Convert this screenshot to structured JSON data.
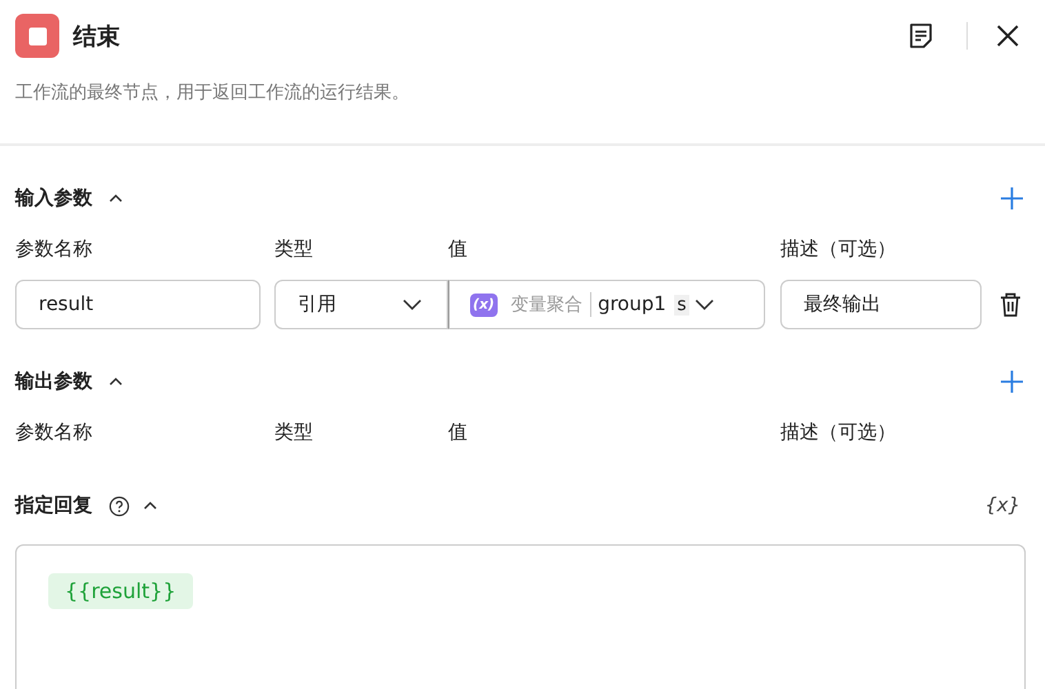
{
  "header": {
    "title": "结束",
    "description": "工作流的最终节点，用于返回工作流的运行结果。"
  },
  "input_section": {
    "title": "输入参数",
    "expanded": true,
    "columns": [
      "参数名称",
      "类型",
      "值",
      "描述（可选）"
    ],
    "rows": [
      {
        "name": "result",
        "type": "引用",
        "value_badge": "(x)",
        "value_source": "变量聚合",
        "value_name": "group1",
        "value_tail": "s",
        "description": "最终输出"
      }
    ]
  },
  "output_section": {
    "title": "输出参数",
    "expanded": true,
    "columns": [
      "参数名称",
      "类型",
      "值",
      "描述（可选）"
    ]
  },
  "reply_section": {
    "title": "指定回复",
    "expanded": true,
    "variable_button": "{x}",
    "tokens": [
      "{{result}}"
    ]
  }
}
